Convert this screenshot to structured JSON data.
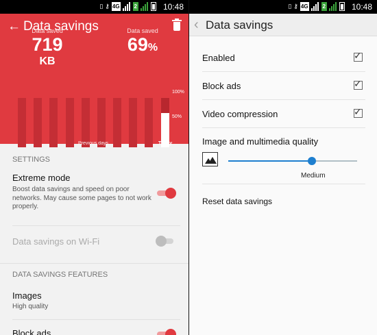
{
  "status_bar": {
    "time": "10:48",
    "network": "4G",
    "sim": "1",
    "sim2": "2",
    "icons": [
      "phone-icon",
      "key-icon",
      "signal-icon",
      "battery-icon"
    ]
  },
  "left": {
    "header": {
      "title": "Data savings",
      "data_saved_label_1": "Data saved",
      "data_saved_value": "719",
      "data_saved_unit": "KB",
      "data_saved_label_2": "Data saved",
      "percent_value": "69",
      "percent_unit": "%"
    },
    "chart": {
      "tick_100": "100%",
      "tick_50": "50%",
      "caption_previous": "Previous days",
      "caption_today": "Today",
      "today_level": 0.69
    },
    "settings_header": "SETTINGS",
    "extreme_mode": {
      "title": "Extreme mode",
      "description": "Boost data savings and speed on poor networks. May cause some pages to not work properly.",
      "enabled": true
    },
    "wifi": {
      "title": "Data savings on Wi-Fi",
      "enabled": false
    },
    "features_header": "DATA SAVINGS FEATURES",
    "images": {
      "title": "Images",
      "value": "High quality"
    },
    "block_ads": {
      "title": "Block ads",
      "enabled": true
    },
    "colors": {
      "accent": "#e03a40"
    }
  },
  "right": {
    "title": "Data savings",
    "items": [
      {
        "label": "Enabled",
        "checked": true
      },
      {
        "label": "Block ads",
        "checked": true
      },
      {
        "label": "Video compression",
        "checked": true
      }
    ],
    "quality": {
      "label": "Image and multimedia quality",
      "value": "Medium",
      "level": 0.65
    },
    "reset_label": "Reset data savings",
    "colors": {
      "accent": "#1e7fcf"
    }
  }
}
